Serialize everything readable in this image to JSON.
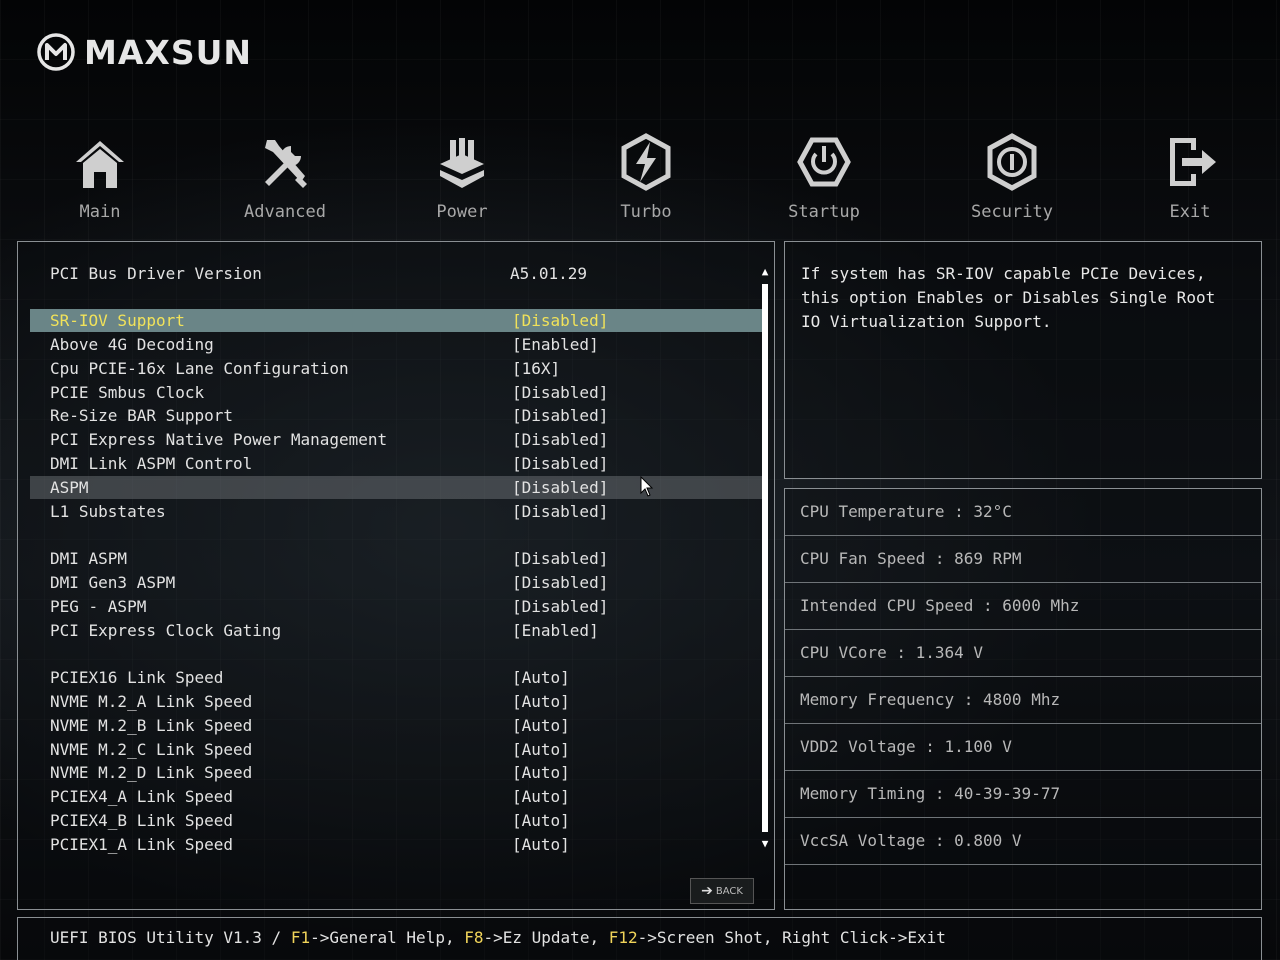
{
  "brand": {
    "name": "MAXSUN"
  },
  "nav": {
    "items": [
      {
        "label": "Main",
        "icon": "home-icon"
      },
      {
        "label": "Advanced",
        "icon": "tools-icon"
      },
      {
        "label": "Power",
        "icon": "power-chip-icon"
      },
      {
        "label": "Turbo",
        "icon": "lightning-icon"
      },
      {
        "label": "Startup",
        "icon": "power-button-icon"
      },
      {
        "label": "Security",
        "icon": "shield-lock-icon"
      },
      {
        "label": "Exit",
        "icon": "exit-icon"
      }
    ]
  },
  "settings": {
    "rows": [
      {
        "label": "PCI Bus Driver Version",
        "value": "A5.01.29"
      },
      {
        "label": "SR-IOV Support",
        "value": "[Disabled]"
      },
      {
        "label": "Above 4G Decoding",
        "value": "[Enabled]"
      },
      {
        "label": "Cpu PCIE-16x Lane Configuration",
        "value": "[16X]"
      },
      {
        "label": "PCIE Smbus Clock",
        "value": "[Disabled]"
      },
      {
        "label": "Re-Size BAR Support",
        "value": "[Disabled]"
      },
      {
        "label": "PCI Express Native Power Management",
        "value": "[Disabled]"
      },
      {
        "label": "DMI Link ASPM Control",
        "value": "[Disabled]"
      },
      {
        "label": "ASPM",
        "value": "[Disabled]"
      },
      {
        "label": "L1 Substates",
        "value": "[Disabled]"
      },
      {
        "label": "DMI ASPM",
        "value": "[Disabled]"
      },
      {
        "label": "DMI Gen3 ASPM",
        "value": "[Disabled]"
      },
      {
        "label": "PEG - ASPM",
        "value": "[Disabled]"
      },
      {
        "label": "PCI Express Clock Gating",
        "value": "[Enabled]"
      },
      {
        "label": "PCIEX16 Link Speed",
        "value": "[Auto]"
      },
      {
        "label": "NVME M.2_A Link Speed",
        "value": "[Auto]"
      },
      {
        "label": "NVME M.2_B Link Speed",
        "value": "[Auto]"
      },
      {
        "label": "NVME M.2_C Link Speed",
        "value": "[Auto]"
      },
      {
        "label": "NVME M.2_D Link Speed",
        "value": "[Auto]"
      },
      {
        "label": "PCIEX4_A Link Speed",
        "value": "[Auto]"
      },
      {
        "label": "PCIEX4_B Link Speed",
        "value": "[Auto]"
      },
      {
        "label": "PCIEX1_A Link Speed",
        "value": "[Auto]"
      }
    ],
    "selected_label": "SR-IOV Support",
    "hovered_label": "ASPM",
    "back_label": "BACK"
  },
  "help": {
    "text": "If system has SR-IOV capable PCIe Devices,\nthis option Enables or Disables Single Root\nIO Virtualization Support."
  },
  "hardware": {
    "rows": [
      "CPU Temperature : 32°C",
      "CPU Fan Speed : 869 RPM",
      "Intended CPU Speed : 6000 Mhz",
      "CPU VCore : 1.364 V",
      "Memory Frequency : 4800 Mhz",
      "VDD2 Voltage : 1.100 V",
      "Memory Timing : 40-39-39-77",
      "VccSA Voltage : 0.800 V"
    ]
  },
  "footer": {
    "prefix": "UEFI BIOS Utility V1.3 / ",
    "key1": "F1",
    "text1": "->General Help, ",
    "key2": "F8",
    "text2": "->Ez Update, ",
    "key3": "F12",
    "text3": "->Screen Shot, Right Click->Exit"
  },
  "colors": {
    "selected_bg": "#6a8587",
    "selected_text": "#f1e25a",
    "key_highlight": "#f1d45a"
  }
}
